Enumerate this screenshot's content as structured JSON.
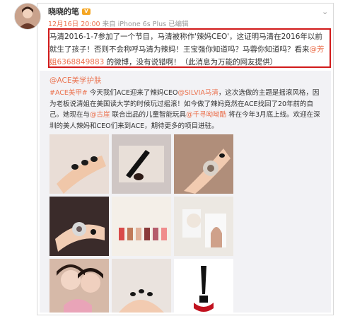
{
  "post": {
    "author": "晓晓的笔",
    "time": "12月16日 20:00",
    "source": "来自 iPhone 6s Plus",
    "edited": "已编辑",
    "text_1": "马清2016-1-7参加了一个节目，马清被称作'辣妈CEO'，这证明马清在2016年以前就生了孩子！否则不会称呼马清为辣妈！王宝强你知道吗？马蓉你知道吗？看来",
    "mention": "@芳姐6368849883",
    "text_2": " 的微博，没有说错啊！（此消息为万能的网友提供）"
  },
  "repost": {
    "author": "@ACE美学护肤",
    "tag": "#ACE美甲#",
    "text_1": " 今天我们ACE迎来了辣妈CEO",
    "mention_1": "@SILVIA马清",
    "text_2": "，这次选做的主题是摇滚风格，因为老板说清姐在美国读大学的时候玩过摇滚！如今做了辣妈竟然在ACE找回了20年前的自己。她现在与",
    "mention_2": "@古崖",
    "text_3": " 联合出品的儿童智能玩具",
    "mention_3": "@千寻呦呦酷",
    "text_4": " 将在今年3月底上线。欢迎在深圳的美人辣妈和CEO们来到ACE，期待更多的项目进驻。"
  },
  "photos": [
    {
      "name": "photo-nails-hand-1"
    },
    {
      "name": "photo-nail-polish-brush"
    },
    {
      "name": "photo-ring-hand"
    },
    {
      "name": "photo-bracelet-rings"
    },
    {
      "name": "photo-polish-bottles"
    },
    {
      "name": "photo-ace-salon-wall"
    },
    {
      "name": "photo-selfie-couple"
    },
    {
      "name": "photo-selfie-two-women"
    },
    {
      "name": "photo-nails-hands-2"
    },
    {
      "name": "photo-louboutin-polish"
    }
  ],
  "colors": {
    "link": "#eb7350",
    "highlight_border": "#d11a1a",
    "repost_bg": "#f2f2f5"
  },
  "icons": [
    "avatar",
    "vip-badge-icon",
    "chevron-down-icon"
  ]
}
